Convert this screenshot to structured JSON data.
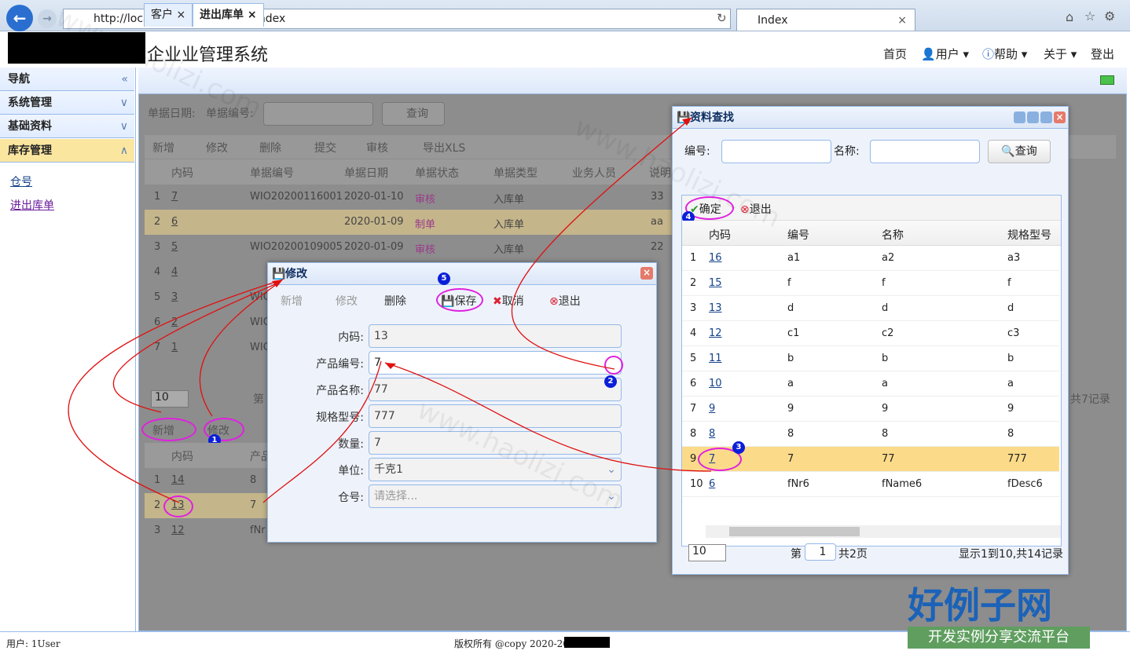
{
  "browser": {
    "address": "http://localhost:41461/Home/Index",
    "tab_title": "Index"
  },
  "app": {
    "title": "企业业管理系统",
    "nav": [
      "首页",
      "用户",
      "帮助",
      "关于",
      "登出"
    ]
  },
  "sidebar": {
    "sections": [
      {
        "label": "导航",
        "chevron": "«"
      },
      {
        "label": "系统管理",
        "chevron": "»"
      },
      {
        "label": "基础资料",
        "chevron": "»"
      },
      {
        "label": "库存管理",
        "chevron": "«"
      }
    ],
    "links": [
      "仓号",
      "进出库单"
    ]
  },
  "main": {
    "tabs": [
      "客户",
      "进出库单"
    ],
    "search": {
      "date_label": "单据日期:",
      "no_label": "单据编号:",
      "query": "查询"
    },
    "toolbar": [
      "新增",
      "修改",
      "删除",
      "提交",
      "审核",
      "导出XLS"
    ],
    "columns": [
      "内码",
      "单据编号",
      "单据日期",
      "单据状态",
      "单据类型",
      "业务人员",
      "说明"
    ],
    "rows": [
      {
        "n": "1",
        "id": "7",
        "no": "WIO20200116001",
        "date": "2020-01-10",
        "status": "审核",
        "type": "入库单",
        "desc": "33"
      },
      {
        "n": "2",
        "id": "6",
        "no": "",
        "date": "2020-01-09",
        "status": "制单",
        "type": "入库单",
        "desc": "aa"
      },
      {
        "n": "3",
        "id": "5",
        "no": "WIO20200109005",
        "date": "2020-01-09",
        "status": "审核",
        "type": "入库单",
        "desc": "22"
      },
      {
        "n": "4",
        "id": "4",
        "no": "",
        "date": "",
        "status": "",
        "type": "",
        "desc": ""
      },
      {
        "n": "5",
        "id": "3",
        "no": "WIC",
        "date": "",
        "status": "",
        "type": "",
        "desc": ""
      },
      {
        "n": "6",
        "id": "2",
        "no": "WIC",
        "date": "",
        "status": "",
        "type": "",
        "desc": ""
      },
      {
        "n": "7",
        "id": "1",
        "no": "WIC",
        "date": "",
        "status": "",
        "type": "",
        "desc": ""
      }
    ],
    "pager": {
      "size": "10",
      "page_label": "第",
      "total": "共7记录"
    },
    "detail_toolbar": [
      "新增",
      "修改"
    ],
    "detail_columns": [
      "内码",
      "产品"
    ],
    "detail_rows": [
      {
        "n": "1",
        "id": "14",
        "p": "8"
      },
      {
        "n": "2",
        "id": "13",
        "p": "7"
      },
      {
        "n": "3",
        "id": "12",
        "p": "fNr"
      }
    ]
  },
  "edit_dialog": {
    "title": "修改",
    "toolbar": [
      "新增",
      "修改",
      "删除",
      "保存",
      "取消",
      "退出"
    ],
    "fields": [
      {
        "label": "内码:",
        "value": "13"
      },
      {
        "label": "产品编号:",
        "value": "7"
      },
      {
        "label": "产品名称:",
        "value": "77"
      },
      {
        "label": "规格型号:",
        "value": "777"
      },
      {
        "label": "数量:",
        "value": "7"
      },
      {
        "label": "单位:",
        "value": "千克1"
      },
      {
        "label": "仓号:",
        "value": "请选择..."
      }
    ]
  },
  "lookup_dialog": {
    "title": "资料查找",
    "no_label": "编号:",
    "name_label": "名称:",
    "query": "查询",
    "confirm": "确定",
    "exit": "退出",
    "columns": [
      "内码",
      "编号",
      "名称",
      "规格型号"
    ],
    "rows": [
      {
        "n": "1",
        "id": "16",
        "no": "a1",
        "name": "a2",
        "spec": "a3"
      },
      {
        "n": "2",
        "id": "15",
        "no": "f",
        "name": "f",
        "spec": "f"
      },
      {
        "n": "3",
        "id": "13",
        "no": "d",
        "name": "d",
        "spec": "d"
      },
      {
        "n": "4",
        "id": "12",
        "no": "c1",
        "name": "c2",
        "spec": "c3"
      },
      {
        "n": "5",
        "id": "11",
        "no": "b",
        "name": "b",
        "spec": "b"
      },
      {
        "n": "6",
        "id": "10",
        "no": "a",
        "name": "a",
        "spec": "a"
      },
      {
        "n": "7",
        "id": "9",
        "no": "9",
        "name": "9",
        "spec": "9"
      },
      {
        "n": "8",
        "id": "8",
        "no": "8",
        "name": "8",
        "spec": "8"
      },
      {
        "n": "9",
        "id": "7",
        "no": "7",
        "name": "77",
        "spec": "777"
      },
      {
        "n": "10",
        "id": "6",
        "no": "fNr6",
        "name": "fName6",
        "spec": "fDesc6"
      }
    ],
    "pager": {
      "size": "10",
      "page_prefix": "第",
      "page": "1",
      "page_suffix": "共2页",
      "info": "显示1到10,共14记录"
    }
  },
  "annotations": [
    "1",
    "2",
    "3",
    "4",
    "5"
  ],
  "footer": {
    "user": "用户: 1User",
    "copyright": "版权所有 @copy 2020-2050"
  },
  "watermark": {
    "text": "www.haolizi.com",
    "brand": "好例子网",
    "slogan": "开发实例分享交流平台"
  }
}
